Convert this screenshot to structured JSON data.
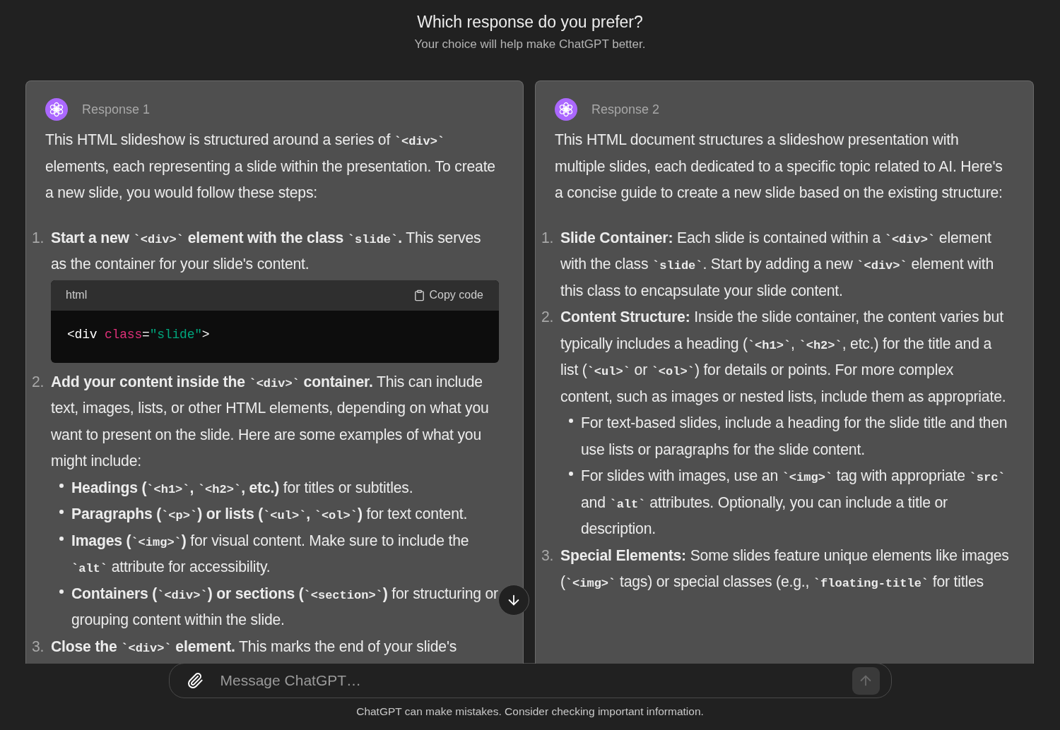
{
  "header": {
    "title": "Which response do you prefer?",
    "subtitle": "Your choice will help make ChatGPT better."
  },
  "responses": [
    {
      "label": "Response 1",
      "intro": [
        {
          "kind": "text",
          "text": "This HTML slideshow is structured around a series of "
        },
        {
          "kind": "code",
          "text": "`<div>`"
        },
        {
          "kind": "text",
          "text": " elements, each representing a slide within the presentation. To create a new slide, you would follow these steps:"
        }
      ],
      "steps": [
        {
          "number": "1.",
          "segments": [
            {
              "kind": "bold",
              "text": "Start a new "
            },
            {
              "kind": "code",
              "text": "`<div>`"
            },
            {
              "kind": "bold",
              "text": " element with the class "
            },
            {
              "kind": "code",
              "text": "`slide`"
            },
            {
              "kind": "bold",
              "text": "."
            },
            {
              "kind": "text",
              "text": " This serves as the container for your slide's content."
            }
          ],
          "code_block": {
            "language": "html",
            "copy_label": "Copy code",
            "tokens": [
              {
                "kind": "plain",
                "text": "<div "
              },
              {
                "kind": "attr",
                "text": "class"
              },
              {
                "kind": "plain",
                "text": "="
              },
              {
                "kind": "string",
                "text": "\"slide\""
              },
              {
                "kind": "plain",
                "text": ">"
              }
            ]
          }
        },
        {
          "number": "2.",
          "segments": [
            {
              "kind": "bold",
              "text": "Add your content inside the "
            },
            {
              "kind": "code",
              "text": "`<div>`"
            },
            {
              "kind": "bold",
              "text": " container."
            },
            {
              "kind": "text",
              "text": " This can include text, images, lists, or other HTML elements, depending on what you want to present on the slide. Here are some examples of what you might include:"
            }
          ],
          "children": [
            [
              {
                "kind": "bold",
                "text": "Headings ("
              },
              {
                "kind": "code",
                "text": "`<h1>`"
              },
              {
                "kind": "bold",
                "text": ", "
              },
              {
                "kind": "code",
                "text": "`<h2>`"
              },
              {
                "kind": "bold",
                "text": ", etc.)"
              },
              {
                "kind": "text",
                "text": " for titles or subtitles."
              }
            ],
            [
              {
                "kind": "bold",
                "text": "Paragraphs ("
              },
              {
                "kind": "code",
                "text": "`<p>`"
              },
              {
                "kind": "bold",
                "text": ") or lists ("
              },
              {
                "kind": "code",
                "text": "`<ul>`"
              },
              {
                "kind": "bold",
                "text": ", "
              },
              {
                "kind": "code",
                "text": "`<ol>`"
              },
              {
                "kind": "bold",
                "text": ")"
              },
              {
                "kind": "text",
                "text": " for text content."
              }
            ],
            [
              {
                "kind": "bold",
                "text": "Images ("
              },
              {
                "kind": "code",
                "text": "`<img>`"
              },
              {
                "kind": "bold",
                "text": ")"
              },
              {
                "kind": "text",
                "text": " for visual content. Make sure to include the "
              },
              {
                "kind": "code",
                "text": "`alt`"
              },
              {
                "kind": "text",
                "text": " attribute for accessibility."
              }
            ],
            [
              {
                "kind": "bold",
                "text": "Containers ("
              },
              {
                "kind": "code",
                "text": "`<div>`"
              },
              {
                "kind": "bold",
                "text": ") or sections ("
              },
              {
                "kind": "code",
                "text": "`<section>`"
              },
              {
                "kind": "bold",
                "text": ")"
              },
              {
                "kind": "text",
                "text": " for structuring or grouping content within the slide."
              }
            ]
          ]
        },
        {
          "number": "3.",
          "segments": [
            {
              "kind": "bold",
              "text": "Close the "
            },
            {
              "kind": "code",
              "text": "`<div>`"
            },
            {
              "kind": "bold",
              "text": " element."
            },
            {
              "kind": "text",
              "text": " This marks the end of your slide's"
            }
          ]
        }
      ]
    },
    {
      "label": "Response 2",
      "intro": [
        {
          "kind": "text",
          "text": "This HTML document structures a slideshow presentation with multiple slides, each dedicated to a specific topic related to AI. Here's a concise guide to create a new slide based on the existing structure:"
        }
      ],
      "steps": [
        {
          "number": "1.",
          "segments": [
            {
              "kind": "bold",
              "text": "Slide Container:"
            },
            {
              "kind": "text",
              "text": " Each slide is contained within a "
            },
            {
              "kind": "code",
              "text": "`<div>`"
            },
            {
              "kind": "text",
              "text": " element with the class "
            },
            {
              "kind": "code",
              "text": "`slide`"
            },
            {
              "kind": "text",
              "text": ". Start by adding a new "
            },
            {
              "kind": "code",
              "text": "`<div>`"
            },
            {
              "kind": "text",
              "text": " element with this class to encapsulate your slide content."
            }
          ]
        },
        {
          "number": "2.",
          "segments": [
            {
              "kind": "bold",
              "text": "Content Structure:"
            },
            {
              "kind": "text",
              "text": " Inside the slide container, the content varies but typically includes a heading ("
            },
            {
              "kind": "code",
              "text": "`<h1>`"
            },
            {
              "kind": "text",
              "text": ", "
            },
            {
              "kind": "code",
              "text": "`<h2>`"
            },
            {
              "kind": "text",
              "text": ", etc.) for the title and a list ("
            },
            {
              "kind": "code",
              "text": "`<ul>`"
            },
            {
              "kind": "text",
              "text": " or "
            },
            {
              "kind": "code",
              "text": "`<ol>`"
            },
            {
              "kind": "text",
              "text": ") for details or points. For more complex content, such as images or nested lists, include them as appropriate."
            }
          ],
          "children": [
            [
              {
                "kind": "text",
                "text": "For text-based slides, include a heading for the slide title and then use lists or paragraphs for the slide content."
              }
            ],
            [
              {
                "kind": "text",
                "text": "For slides with images, use an "
              },
              {
                "kind": "code",
                "text": "`<img>`"
              },
              {
                "kind": "text",
                "text": " tag with appropriate "
              },
              {
                "kind": "code",
                "text": "`src`"
              },
              {
                "kind": "text",
                "text": " and "
              },
              {
                "kind": "code",
                "text": "`alt`"
              },
              {
                "kind": "text",
                "text": " attributes. Optionally, you can include a title or description."
              }
            ]
          ]
        },
        {
          "number": "3.",
          "segments": [
            {
              "kind": "bold",
              "text": "Special Elements:"
            },
            {
              "kind": "text",
              "text": " Some slides feature unique elements like images ("
            },
            {
              "kind": "code",
              "text": "`<img>`"
            },
            {
              "kind": "text",
              "text": " tags) or special classes (e.g., "
            },
            {
              "kind": "code",
              "text": "`floating-title`"
            },
            {
              "kind": "text",
              "text": " for titles"
            }
          ]
        }
      ]
    }
  ],
  "composer": {
    "placeholder": "Message ChatGPT…",
    "send_disabled": true
  },
  "disclaimer": "ChatGPT can make mistakes. Consider checking important information."
}
